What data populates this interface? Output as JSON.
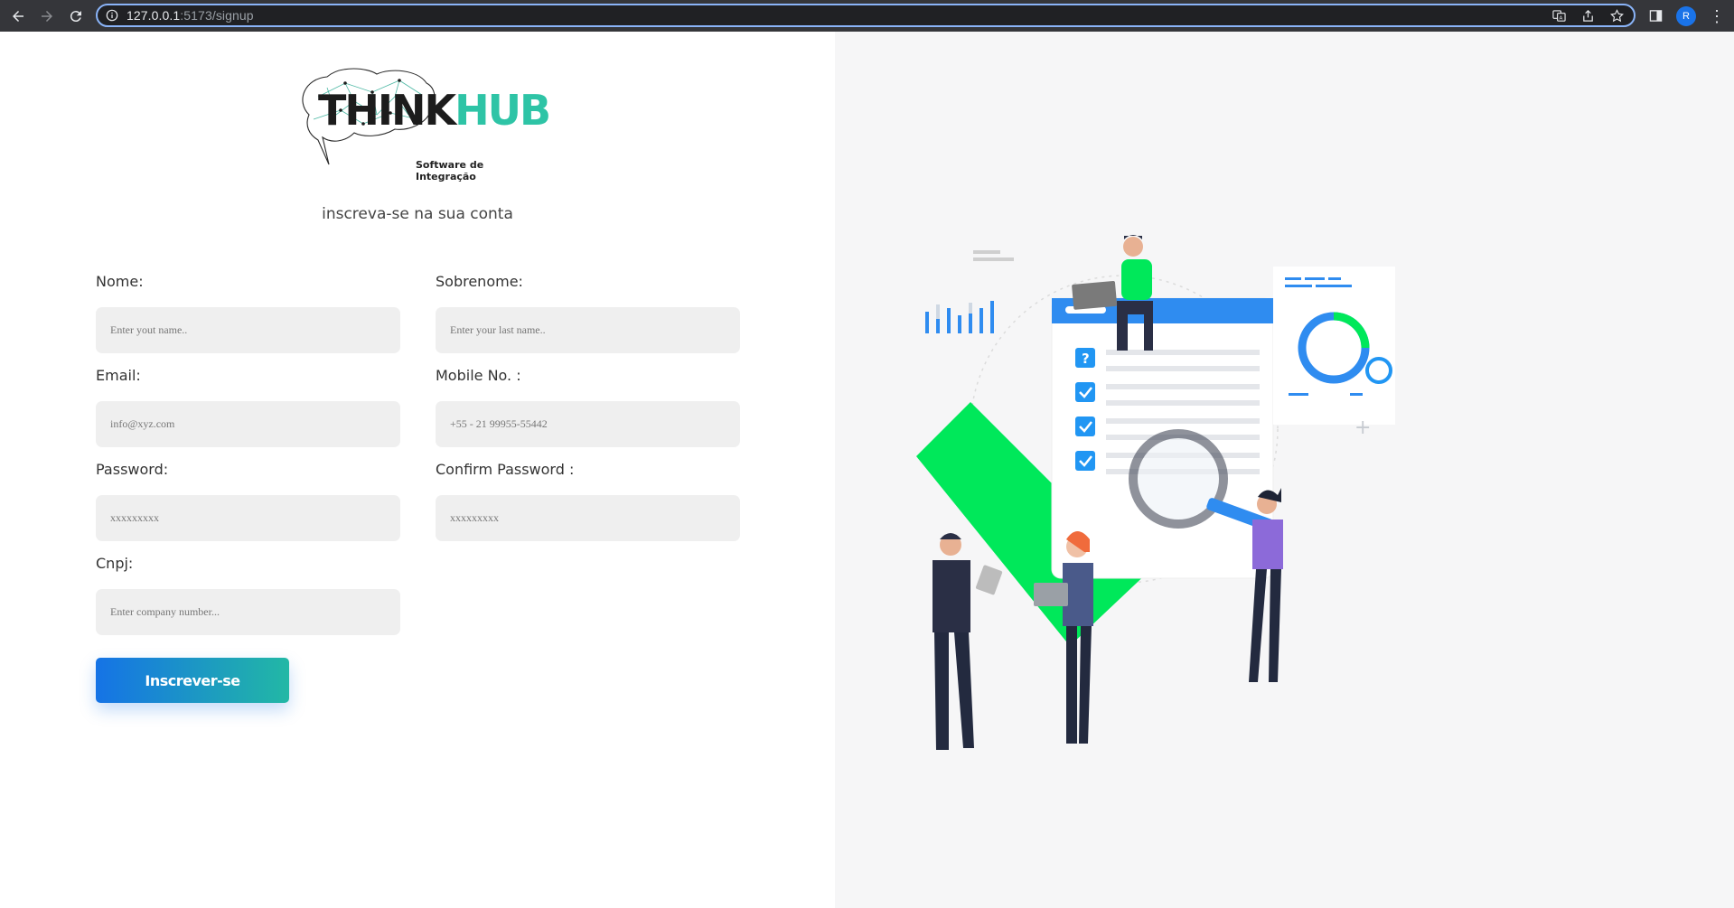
{
  "browser": {
    "url_host": "127.0.0.1",
    "url_path": ":5173/signup"
  },
  "logo": {
    "think": "THINK",
    "hub": "HUB",
    "tagline": "Software de Integração"
  },
  "form": {
    "subtitle": "inscreva-se na sua conta",
    "fields": {
      "nome": {
        "label": "Nome:",
        "placeholder": "Enter yout name.."
      },
      "sobrenome": {
        "label": "Sobrenome:",
        "placeholder": "Enter your last name.."
      },
      "email": {
        "label": "Email:",
        "placeholder": "info@xyz.com"
      },
      "mobile": {
        "label": "Mobile No. :",
        "placeholder": "+55 - 21 99955-55442"
      },
      "password": {
        "label": "Password:",
        "placeholder": "xxxxxxxxx"
      },
      "confirm_password": {
        "label": "Confirm Password :",
        "placeholder": "xxxxxxxxx"
      },
      "cnpj": {
        "label": "Cnpj:",
        "placeholder": "Enter company number..."
      }
    },
    "submit_label": "Inscrever-se"
  },
  "colors": {
    "accent_blue": "#1573e6",
    "accent_teal": "#22b8a5",
    "illustration_green": "#00e85a",
    "illustration_blue": "#2f8cf0"
  }
}
